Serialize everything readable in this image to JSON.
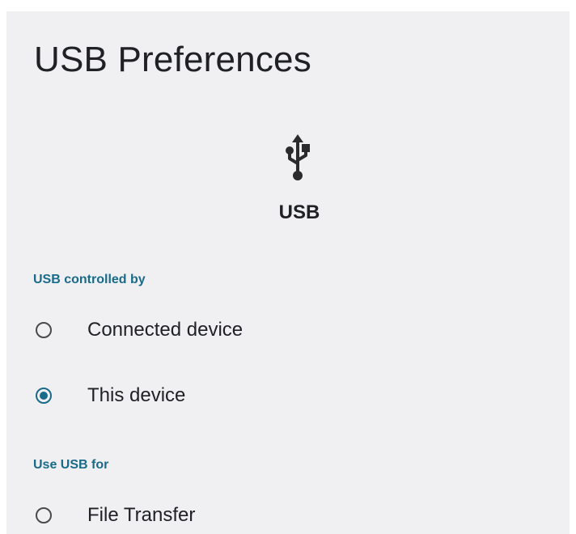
{
  "header": {
    "title": "USB Preferences"
  },
  "device": {
    "icon": "usb-icon",
    "label": "USB"
  },
  "sections": {
    "controlled_by": {
      "header": "USB controlled by",
      "options": [
        {
          "label": "Connected device",
          "selected": false
        },
        {
          "label": "This device",
          "selected": true
        }
      ]
    },
    "use_for": {
      "header": "Use USB for",
      "options": [
        {
          "label": "File Transfer",
          "selected": false
        }
      ]
    }
  },
  "colors": {
    "accent": "#1a6a8a",
    "background": "#f0f0f2",
    "text": "#202124"
  }
}
